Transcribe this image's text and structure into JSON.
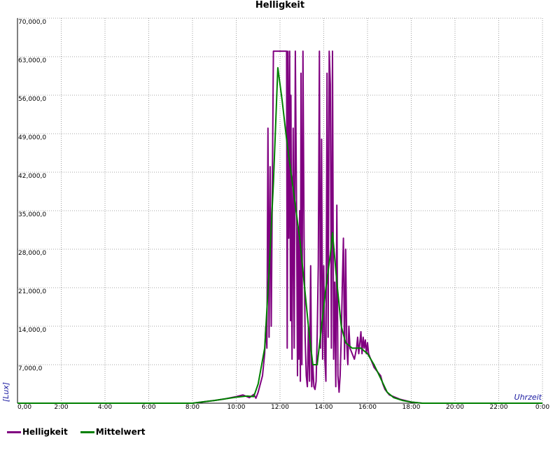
{
  "chart_data": {
    "type": "line",
    "title": "Helligkeit",
    "xlabel": "Uhrzeit",
    "ylabel": "[Lux]",
    "xlim": [
      0,
      24
    ],
    "ylim": [
      0,
      70000
    ],
    "x_ticks": [
      "0,00",
      "2:00",
      "4:00",
      "6:00",
      "8:00",
      "10:00",
      "12:00",
      "14:00",
      "16:00",
      "18:00",
      "20:00",
      "22:00",
      "0:00"
    ],
    "y_ticks": [
      "7,000,0",
      "14,000,0",
      "21,000,0",
      "28,000,0",
      "35,000,0",
      "42,000,0",
      "49,000,0",
      "56,000,0",
      "63,000,0",
      "70,000,0"
    ],
    "grid": true,
    "legend_position": "bottom-left",
    "series": [
      {
        "name": "Helligkeit",
        "color": "#800080",
        "points": [
          [
            0,
            0
          ],
          [
            6,
            0
          ],
          [
            8,
            0
          ],
          [
            8.6,
            300
          ],
          [
            9,
            500
          ],
          [
            9.5,
            800
          ],
          [
            10,
            1200
          ],
          [
            10.3,
            1500
          ],
          [
            10.6,
            1000
          ],
          [
            10.8,
            1600
          ],
          [
            10.9,
            900
          ],
          [
            11.0,
            2000
          ],
          [
            11.2,
            5000
          ],
          [
            11.3,
            9000
          ],
          [
            11.35,
            14000
          ],
          [
            11.4,
            10000
          ],
          [
            11.45,
            50000
          ],
          [
            11.5,
            12000
          ],
          [
            11.55,
            43000
          ],
          [
            11.6,
            14000
          ],
          [
            11.7,
            64000
          ],
          [
            11.8,
            64000
          ],
          [
            11.9,
            64000
          ],
          [
            12.0,
            64000
          ],
          [
            12.2,
            64000
          ],
          [
            12.3,
            64000
          ],
          [
            12.33,
            10000
          ],
          [
            12.36,
            64000
          ],
          [
            12.4,
            30000
          ],
          [
            12.44,
            64000
          ],
          [
            12.48,
            15000
          ],
          [
            12.5,
            56000
          ],
          [
            12.55,
            8000
          ],
          [
            12.6,
            50000
          ],
          [
            12.65,
            10000
          ],
          [
            12.7,
            64000
          ],
          [
            12.75,
            40000
          ],
          [
            12.8,
            5000
          ],
          [
            12.83,
            32000
          ],
          [
            12.86,
            8000
          ],
          [
            12.9,
            35000
          ],
          [
            12.93,
            4000
          ],
          [
            12.96,
            60000
          ],
          [
            13.0,
            7000
          ],
          [
            13.05,
            64000
          ],
          [
            13.1,
            30000
          ],
          [
            13.15,
            12000
          ],
          [
            13.2,
            5000
          ],
          [
            13.25,
            3000
          ],
          [
            13.3,
            14000
          ],
          [
            13.35,
            4000
          ],
          [
            13.4,
            25000
          ],
          [
            13.45,
            3000
          ],
          [
            13.5,
            7000
          ],
          [
            13.55,
            3000
          ],
          [
            13.6,
            2500
          ],
          [
            13.65,
            4000
          ],
          [
            13.7,
            12000
          ],
          [
            13.75,
            25000
          ],
          [
            13.8,
            64000
          ],
          [
            13.85,
            10000
          ],
          [
            13.9,
            48000
          ],
          [
            13.95,
            8000
          ],
          [
            14.0,
            25000
          ],
          [
            14.05,
            8000
          ],
          [
            14.1,
            4000
          ],
          [
            14.15,
            60000
          ],
          [
            14.2,
            12000
          ],
          [
            14.25,
            64000
          ],
          [
            14.3,
            58000
          ],
          [
            14.35,
            10000
          ],
          [
            14.4,
            64000
          ],
          [
            14.45,
            8000
          ],
          [
            14.5,
            22000
          ],
          [
            14.55,
            3000
          ],
          [
            14.6,
            36000
          ],
          [
            14.65,
            5000
          ],
          [
            14.7,
            2000
          ],
          [
            14.75,
            5000
          ],
          [
            14.8,
            12000
          ],
          [
            14.85,
            22000
          ],
          [
            14.9,
            30000
          ],
          [
            14.95,
            8000
          ],
          [
            15.0,
            28000
          ],
          [
            15.05,
            11000
          ],
          [
            15.1,
            7000
          ],
          [
            15.15,
            14000
          ],
          [
            15.2,
            10000
          ],
          [
            15.3,
            9000
          ],
          [
            15.4,
            8000
          ],
          [
            15.5,
            10000
          ],
          [
            15.55,
            12000
          ],
          [
            15.6,
            9000
          ],
          [
            15.65,
            11000
          ],
          [
            15.7,
            13000
          ],
          [
            15.75,
            9000
          ],
          [
            15.8,
            12000
          ],
          [
            15.85,
            10000
          ],
          [
            15.9,
            11500
          ],
          [
            15.95,
            9000
          ],
          [
            16.0,
            11000
          ],
          [
            16.05,
            9000
          ],
          [
            16.1,
            8500
          ],
          [
            16.2,
            7500
          ],
          [
            16.3,
            6500
          ],
          [
            16.4,
            6000
          ],
          [
            16.5,
            5500
          ],
          [
            16.6,
            5000
          ],
          [
            16.7,
            3500
          ],
          [
            16.8,
            2500
          ],
          [
            17.0,
            1500
          ],
          [
            17.5,
            700
          ],
          [
            18.0,
            200
          ],
          [
            18.5,
            0
          ],
          [
            24,
            0
          ]
        ]
      },
      {
        "name": "Mittelwert",
        "color": "#008000",
        "points": [
          [
            0,
            0
          ],
          [
            6,
            0
          ],
          [
            8,
            0
          ],
          [
            8.6,
            300
          ],
          [
            9,
            500
          ],
          [
            9.5,
            800
          ],
          [
            10,
            1100
          ],
          [
            10.5,
            1300
          ],
          [
            10.8,
            1200
          ],
          [
            11.0,
            3500
          ],
          [
            11.3,
            10000
          ],
          [
            11.5,
            24000
          ],
          [
            11.7,
            40000
          ],
          [
            11.9,
            61000
          ],
          [
            12.1,
            55000
          ],
          [
            12.3,
            48000
          ],
          [
            12.5,
            42000
          ],
          [
            12.7,
            36000
          ],
          [
            12.9,
            30000
          ],
          [
            13.1,
            22000
          ],
          [
            13.3,
            14000
          ],
          [
            13.5,
            7000
          ],
          [
            13.7,
            7000
          ],
          [
            13.9,
            14000
          ],
          [
            14.1,
            21000
          ],
          [
            14.3,
            27000
          ],
          [
            14.4,
            31000
          ],
          [
            14.6,
            22000
          ],
          [
            14.8,
            14000
          ],
          [
            15.0,
            11000
          ],
          [
            15.3,
            10000
          ],
          [
            15.7,
            10000
          ],
          [
            16.0,
            9000
          ],
          [
            16.3,
            7000
          ],
          [
            16.6,
            4500
          ],
          [
            16.9,
            2000
          ],
          [
            17.2,
            1000
          ],
          [
            17.6,
            500
          ],
          [
            18.0,
            200
          ],
          [
            18.5,
            0
          ],
          [
            24,
            0
          ]
        ]
      }
    ]
  }
}
